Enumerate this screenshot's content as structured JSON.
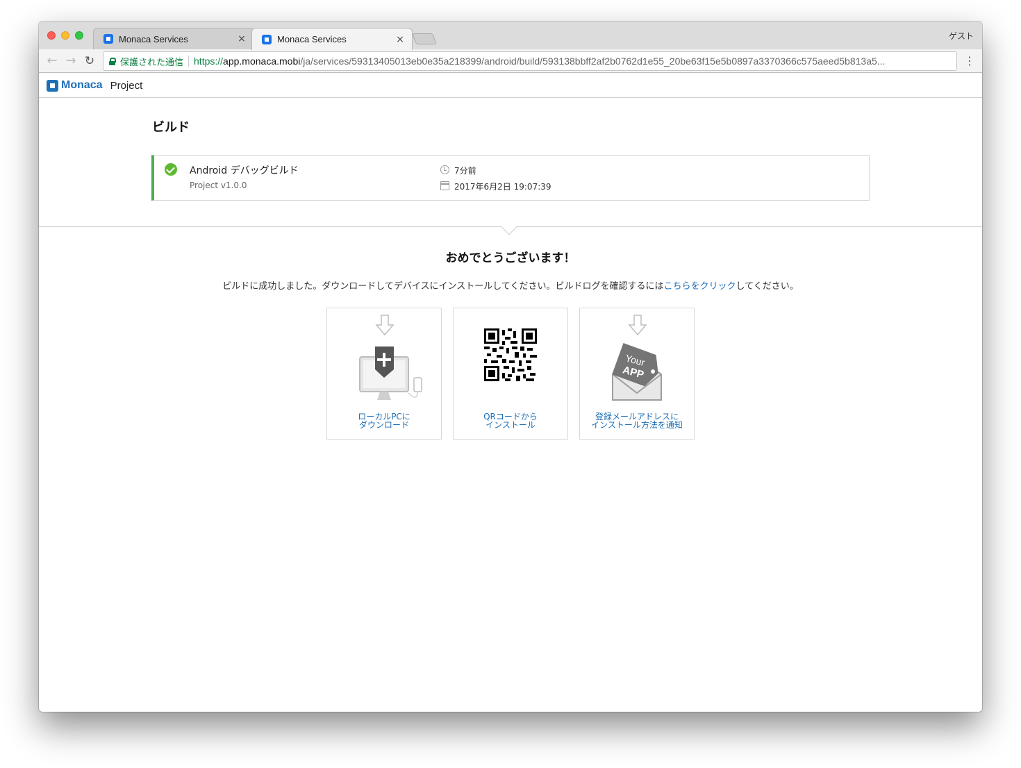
{
  "browser": {
    "tabs": [
      {
        "title": "Monaca Services",
        "close": "×"
      },
      {
        "title": "Monaca Services",
        "close": "×"
      }
    ],
    "profile": "ゲスト",
    "nav": {
      "back": "←",
      "forward": "→",
      "reload": "↻",
      "menu": "⋮"
    },
    "omnibox": {
      "secure_label": "保護された通信",
      "url_scheme": "https://",
      "url_host": "app.monaca.mobi",
      "url_path": "/ja/services/59313405013eb0e35a218399/android/build/593138bbff2af2b0762d1e55_20be63f15e5b0897a3370366c575aeed5b813a5..."
    }
  },
  "app_header": {
    "logo_text": "Monaca",
    "project_label": "Project"
  },
  "page": {
    "title": "ビルド",
    "build": {
      "name": "Android デバッグビルド",
      "subtitle": "Project v1.0.0",
      "time_ago": "7分前",
      "datetime": "2017年6月2日 19:07:39",
      "status_color": "#4caf50"
    },
    "congrats": "おめでとうございます！",
    "message": {
      "before": "ビルドに成功しました。ダウンロードしてデバイスにインストールしてください。ビルドログを確認するには",
      "link": "こちらをクリック",
      "after": "してください。"
    },
    "options": [
      {
        "line1": "ローカルPCに",
        "line2": "ダウンロード",
        "icon": "monitor-download-icon"
      },
      {
        "line1": "QRコードから",
        "line2": "インストール",
        "icon": "qr-code-icon"
      },
      {
        "line1": "登録メールアドレスに",
        "line2": "インストール方法を通知",
        "icon": "mail-app-icon",
        "badge_text_1": "Your",
        "badge_text_2": "APP"
      }
    ]
  },
  "colors": {
    "accent": "#1d6fb8",
    "success": "#5fb832",
    "secure": "#0b8043"
  }
}
